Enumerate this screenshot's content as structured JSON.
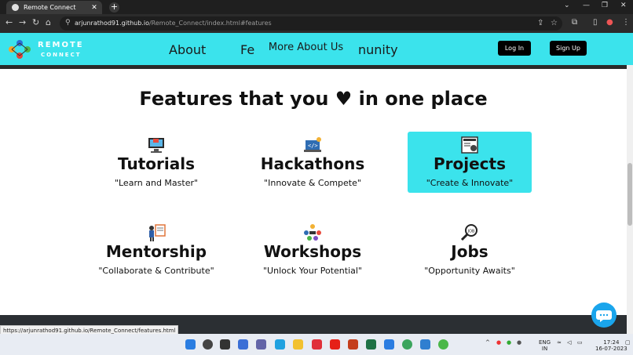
{
  "browser": {
    "tab_title": "Remote Connect",
    "url_domain": "arjunrathod91.github.io",
    "url_path": "/Remote_Connect/index.html#features",
    "status_url": "https://arjunrathod91.github.io/Remote_Connect/features.html"
  },
  "header": {
    "brand_line1": "REMOTE",
    "brand_line2": "CONNECT",
    "nav": [
      "About",
      "Fe",
      "nunity"
    ],
    "tooltip": "More About Us",
    "login": "Log In",
    "signup": "Sign Up"
  },
  "main": {
    "heading": "Features that you ♥ in one place",
    "features": [
      {
        "title": "Tutorials",
        "subtitle": "\"Learn and Master\"",
        "icon": "monitor-video-icon"
      },
      {
        "title": "Hackathons",
        "subtitle": "\"Innovate & Compete\"",
        "icon": "code-laptop-icon"
      },
      {
        "title": "Projects",
        "subtitle": "\"Create & Innovate\"",
        "icon": "project-board-icon"
      },
      {
        "title": "Mentorship",
        "subtitle": "\"Collaborate & Contribute\"",
        "icon": "presenter-icon"
      },
      {
        "title": "Workshops",
        "subtitle": "\"Unlock Your Potential\"",
        "icon": "team-meeting-icon"
      },
      {
        "title": "Jobs",
        "subtitle": "\"Opportunity Awaits\"",
        "icon": "job-search-icon"
      }
    ]
  },
  "taskbar": {
    "lang_top": "ENG",
    "lang_bottom": "IN",
    "time": "17:24",
    "date": "16-07-2023"
  },
  "colors": {
    "accent": "#3be3ec",
    "dark": "#2b2f33"
  }
}
